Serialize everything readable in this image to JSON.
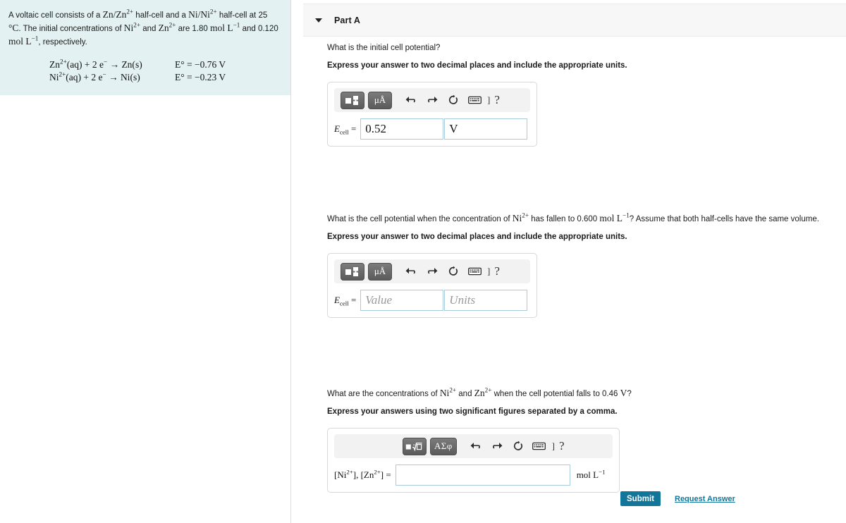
{
  "problem": {
    "paragraph_part1": "A voltaic cell consists of a ",
    "statement_line1_a": "A voltaic cell consists of a",
    "zn_couple": "Zn/Zn",
    "ni_couple": "Ni/Ni",
    "halfcell_word": "half-cell and a",
    "halfcell_word2": "half-cell at 25",
    "temperature": "25 °C.",
    "line2_lead": "The initial concentrations of",
    "line2_mid": "and",
    "line2_are": "are 1.80 mol L",
    "line2_and": "and 0.120",
    "line3": "mol L",
    "line3_tail": ", respectively.",
    "conc_ni": "1.80",
    "conc_zn": "0.120",
    "equations": [
      {
        "lhs": "Zn2+(aq) + 2 e− → Zn(s)",
        "rhs": "E° = −0.76 V",
        "species": "Zn",
        "product": "Zn",
        "potential": "-0.76 V"
      },
      {
        "lhs": "Ni2+(aq) + 2 e− → Ni(s)",
        "rhs": "E° = −0.23 V",
        "species": "Ni",
        "product": "Ni",
        "potential": "-0.23 V"
      }
    ]
  },
  "header": {
    "part_label": "Part A",
    "caret_icon": "chevron-down-icon"
  },
  "toolbar": {
    "template_icon": "math-template-icon",
    "radical_icon": "radical-template-icon",
    "units_label": "μÅ",
    "greek_label": "ΑΣφ",
    "undo_icon": "undo-arrow-icon",
    "redo_icon": "redo-arrow-icon",
    "reset_icon": "reset-circle-icon",
    "keyboard_icon": "keyboard-icon",
    "bracket_label": "]",
    "help_label": "?"
  },
  "questions": [
    {
      "id": "q1",
      "prompt": "What is the initial cell potential?",
      "instruction": "Express your answer to two decimal places and include the appropriate units.",
      "label_main": "E",
      "label_sub": "cell",
      "label_eq": "=",
      "value": "0.52",
      "units": "V",
      "value_placeholder": "Value",
      "units_placeholder": "Units"
    },
    {
      "id": "q2",
      "prompt": "What is the cell potential when the concentration of Ni2+ has fallen to 0.600 mol L−1? Assume that both half-cells have the same volume.",
      "prompt_a": "What is the cell potential when the concentration of",
      "prompt_b": "has fallen to 0.600",
      "prompt_c": "? Assume that both half-cells have the same volume.",
      "concentration": "0.600",
      "instruction": "Express your answer to two decimal places and include the appropriate units.",
      "label_main": "E",
      "label_sub": "cell",
      "label_eq": "=",
      "value": "",
      "units": "",
      "value_placeholder": "Value",
      "units_placeholder": "Units"
    },
    {
      "id": "q3",
      "prompt": "What are the concentrations of Ni2+ and Zn2+ when the cell potential falls to 0.46 V?",
      "prompt_a": "What are the concentrations of",
      "prompt_b": "and",
      "prompt_c": "when the cell potential falls to 0.46",
      "potential_value": "0.46",
      "instruction": "Express your answers using two significant figures separated by a comma.",
      "label_eq": "=",
      "value": "",
      "value_placeholder": "",
      "trailing_units": "mol L−1"
    }
  ],
  "footer": {
    "submit_label": "Submit",
    "request_answer_label": "Request Answer"
  },
  "colors": {
    "problem_background": "#e3f1f2",
    "submit_teal": "#12769a",
    "link_teal": "#12769a",
    "field_border": "#a9cbdc",
    "header_band": "#f7f7f7",
    "toolbar_background": "#f2f2f2",
    "toolbar_button": "#5b5b5b"
  }
}
